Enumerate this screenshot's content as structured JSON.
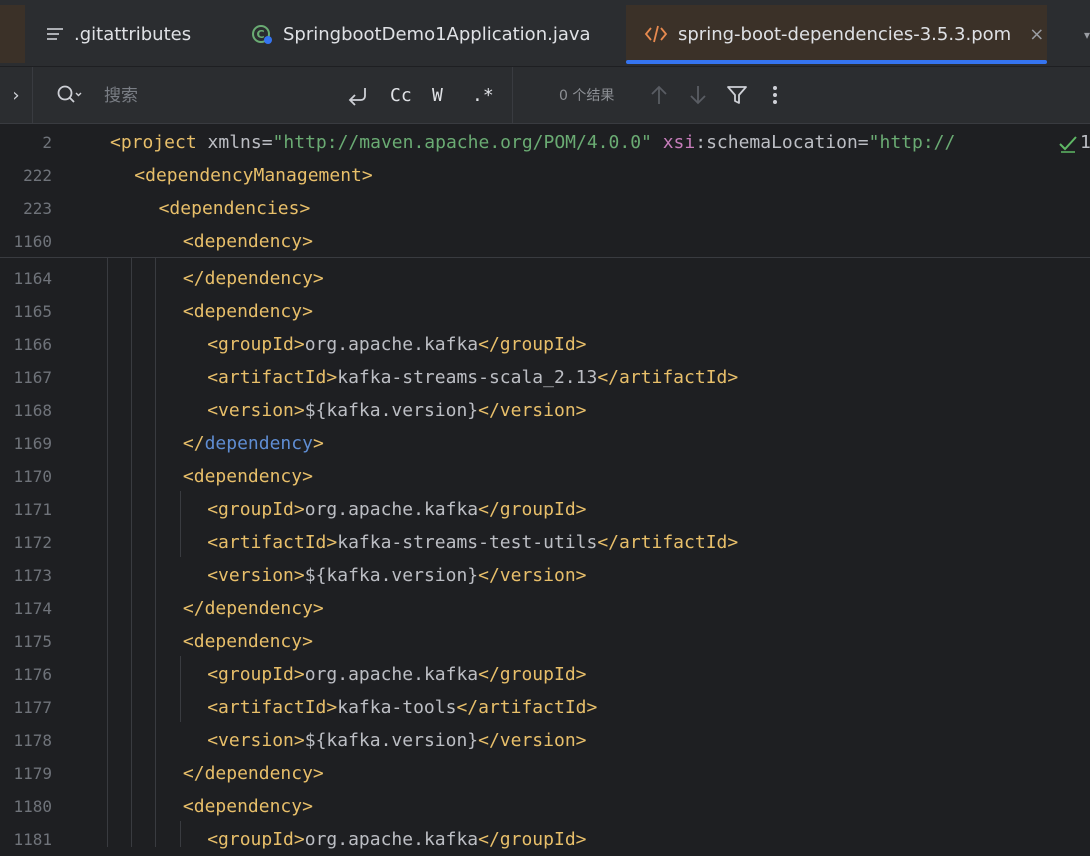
{
  "tabs": [
    {
      "label": ".gitattributes",
      "icon": "text-file-icon"
    },
    {
      "label": "SpringbootDemo1Application.java",
      "icon": "spring-boot-icon"
    },
    {
      "label": "spring-boot-dependencies-3.5.3.pom",
      "icon": "xml-file-icon",
      "active": true,
      "close": "×"
    }
  ],
  "search": {
    "placeholder": "搜索",
    "options": {
      "regex": ".*",
      "case": "Cc",
      "word": "W"
    },
    "results": "0 个结果"
  },
  "sticky_lines": [
    {
      "num": "2",
      "parts": [
        [
          "t",
          "<project "
        ],
        [
          "at",
          "xmlns"
        ],
        [
          "tx",
          "="
        ],
        [
          "av",
          "\"http://maven.apache.org/POM/4.0.0\""
        ],
        [
          "tx",
          " "
        ],
        [
          "ns",
          "xsi"
        ],
        [
          "at",
          ":schemaLocation"
        ],
        [
          "tx",
          "="
        ],
        [
          "av",
          "\"http://"
        ]
      ]
    },
    {
      "num": "222",
      "parts": [
        [
          "t",
          "<dependencyManagement>"
        ]
      ]
    },
    {
      "num": "223",
      "parts": [
        [
          "t",
          "<dependencies>"
        ]
      ]
    },
    {
      "num": "1160",
      "parts": [
        [
          "t",
          "<dependency>"
        ]
      ]
    }
  ],
  "lines": [
    {
      "num": "1164",
      "indent": 3,
      "parts": [
        [
          "t",
          "</dependency>"
        ]
      ]
    },
    {
      "num": "1165",
      "indent": 3,
      "parts": [
        [
          "t",
          "<dependency>"
        ]
      ]
    },
    {
      "num": "1166",
      "indent": 4,
      "parts": [
        [
          "t",
          "<groupId>"
        ],
        [
          "tx",
          "org.apache.kafka"
        ],
        [
          "t",
          "</groupId>"
        ]
      ]
    },
    {
      "num": "1167",
      "indent": 4,
      "parts": [
        [
          "t",
          "<artifactId>"
        ],
        [
          "tx",
          "kafka-streams-scala_2.13"
        ],
        [
          "t",
          "</artifactId>"
        ]
      ]
    },
    {
      "num": "1168",
      "indent": 4,
      "parts": [
        [
          "t",
          "<version>"
        ],
        [
          "tx",
          "${kafka.version}"
        ],
        [
          "t",
          "</version>"
        ]
      ]
    },
    {
      "num": "1169",
      "indent": 3,
      "parts": [
        [
          "t",
          "</"
        ],
        [
          "hl",
          "dependency"
        ],
        [
          "t",
          ">"
        ]
      ]
    },
    {
      "num": "1170",
      "indent": 3,
      "parts": [
        [
          "t",
          "<dependency>"
        ]
      ]
    },
    {
      "num": "1171",
      "indent": 4,
      "parts": [
        [
          "t",
          "<groupId>"
        ],
        [
          "tx",
          "org.apache.kafka"
        ],
        [
          "t",
          "</groupId>"
        ]
      ]
    },
    {
      "num": "1172",
      "indent": 4,
      "parts": [
        [
          "t",
          "<artifactId>"
        ],
        [
          "tx",
          "kafka-streams-test-utils"
        ],
        [
          "t",
          "</artifactId>"
        ]
      ]
    },
    {
      "num": "1173",
      "indent": 4,
      "parts": [
        [
          "t",
          "<version>"
        ],
        [
          "tx",
          "${kafka.version}"
        ],
        [
          "t",
          "</version>"
        ]
      ]
    },
    {
      "num": "1174",
      "indent": 3,
      "parts": [
        [
          "t",
          "</dependency>"
        ]
      ]
    },
    {
      "num": "1175",
      "indent": 3,
      "parts": [
        [
          "t",
          "<dependency>"
        ]
      ]
    },
    {
      "num": "1176",
      "indent": 4,
      "parts": [
        [
          "t",
          "<groupId>"
        ],
        [
          "tx",
          "org.apache.kafka"
        ],
        [
          "t",
          "</groupId>"
        ]
      ]
    },
    {
      "num": "1177",
      "indent": 4,
      "parts": [
        [
          "t",
          "<artifactId>"
        ],
        [
          "tx",
          "kafka-tools"
        ],
        [
          "t",
          "</artifactId>"
        ]
      ]
    },
    {
      "num": "1178",
      "indent": 4,
      "parts": [
        [
          "t",
          "<version>"
        ],
        [
          "tx",
          "${kafka.version}"
        ],
        [
          "t",
          "</version>"
        ]
      ]
    },
    {
      "num": "1179",
      "indent": 3,
      "parts": [
        [
          "t",
          "</dependency>"
        ]
      ]
    },
    {
      "num": "1180",
      "indent": 3,
      "parts": [
        [
          "t",
          "<dependency>"
        ]
      ]
    },
    {
      "num": "1181",
      "indent": 4,
      "parts": [
        [
          "t",
          "<groupId>"
        ],
        [
          "tx",
          "org.apache.kafka"
        ],
        [
          "t",
          "</groupId>"
        ]
      ]
    }
  ],
  "inspection_overflow": "1",
  "colors": {
    "tag": "#e8bf6a",
    "text": "#bcbec4",
    "attr_value": "#6aab73",
    "namespace": "#c77dbb",
    "highlight": "#5f8dd3",
    "accent": "#3574f0"
  }
}
